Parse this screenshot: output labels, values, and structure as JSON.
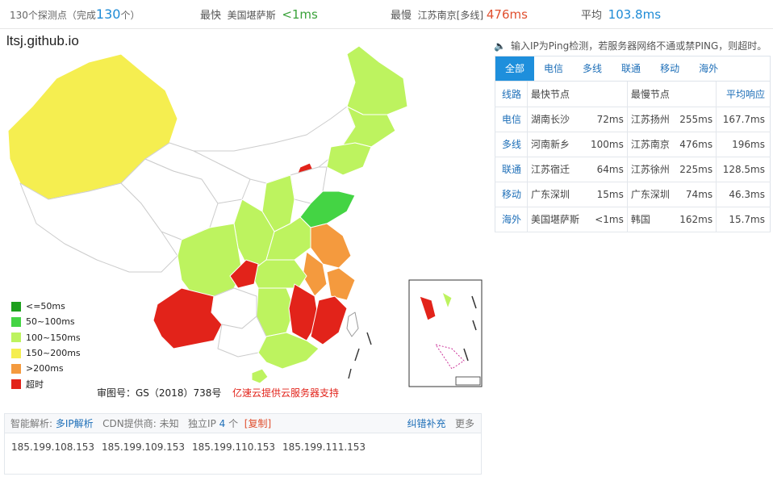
{
  "summary": {
    "probes_label": "130个探测点（完成",
    "probes_count": "130",
    "probes_suffix": "个）",
    "fastest_label": "最快",
    "fastest_node": "美国堪萨斯",
    "fastest_value": "<1ms",
    "slowest_label": "最慢",
    "slowest_node": "江苏南京[多线]",
    "slowest_value": "476ms",
    "avg_label": "平均",
    "avg_value": "103.8ms"
  },
  "map": {
    "site": "ltsj.github.io",
    "legend": [
      {
        "label": "<=50ms",
        "color": "#1ea01e"
      },
      {
        "label": "50~100ms",
        "color": "#44d444"
      },
      {
        "label": "100~150ms",
        "color": "#bdf35f"
      },
      {
        "label": "150~200ms",
        "color": "#f5ee50"
      },
      {
        "label": ">200ms",
        "color": "#f49a3e"
      },
      {
        "label": "超时",
        "color": "#e2231a"
      }
    ],
    "approval": "审图号：GS（2018）738号",
    "sponsor": "亿速云提供云服务器支持"
  },
  "panel": {
    "hint": "输入IP为Ping检测，若服务器网络不通或禁PING，则超时。",
    "tabs": [
      "全部",
      "电信",
      "多线",
      "联通",
      "移动",
      "海外"
    ],
    "headers": {
      "line": "线路",
      "fastest": "最快节点",
      "slowest": "最慢节点",
      "avg": "平均响应"
    },
    "rows": [
      {
        "line": "电信",
        "fast_node": "湖南长沙",
        "fast_ms": "72ms",
        "slow_node": "江苏扬州",
        "slow_ms": "255ms",
        "avg": "167.7ms"
      },
      {
        "line": "多线",
        "fast_node": "河南新乡",
        "fast_ms": "100ms",
        "slow_node": "江苏南京",
        "slow_ms": "476ms",
        "avg": "196ms"
      },
      {
        "line": "联通",
        "fast_node": "江苏宿迁",
        "fast_ms": "64ms",
        "slow_node": "江苏徐州",
        "slow_ms": "225ms",
        "avg": "128.5ms"
      },
      {
        "line": "移动",
        "fast_node": "广东深圳",
        "fast_ms": "15ms",
        "slow_node": "广东深圳",
        "slow_ms": "74ms",
        "avg": "46.3ms"
      },
      {
        "line": "海外",
        "fast_node": "美国堪萨斯",
        "fast_ms": "<1ms",
        "slow_node": "韩国",
        "slow_ms": "162ms",
        "avg": "15.7ms"
      }
    ]
  },
  "dns": {
    "smart_label": "智能解析:",
    "smart_value": "多IP解析",
    "cdn_label": "CDN提供商: 未知",
    "ip_label": "独立IP",
    "ip_count": "4",
    "ip_unit": "个",
    "copy": "[复制]",
    "report": "纠错补充",
    "more": "更多",
    "ips": [
      "185.199.108.153",
      "185.199.109.153",
      "185.199.110.153",
      "185.199.111.153"
    ]
  }
}
